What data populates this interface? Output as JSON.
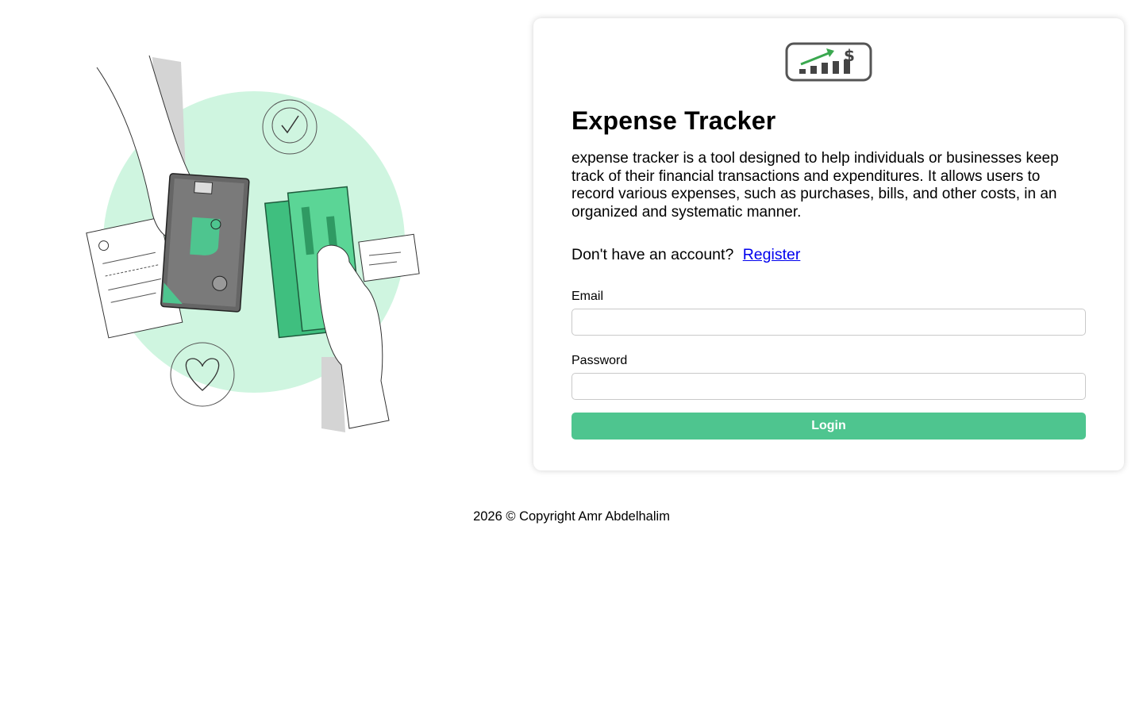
{
  "app": {
    "title": "Expense Tracker",
    "description": "expense tracker is a tool designed to help individuals or businesses keep track of their financial transactions and expenditures. It allows users to record various expenses, such as purchases, bills, and other costs, in an organized and systematic manner."
  },
  "register": {
    "prompt": "Don't have an account?",
    "link_label": "Register"
  },
  "form": {
    "email_label": "Email",
    "email_value": "",
    "password_label": "Password",
    "password_value": "",
    "login_label": "Login"
  },
  "footer": {
    "copyright": "2026 © Copyright Amr Abdelhalim"
  },
  "colors": {
    "accent": "#4ec58f",
    "link": "#0000ee",
    "illustration_bg": "#cff5e0",
    "logo_arrow": "#3aa84f"
  },
  "icons": {
    "logo": "expense-chart-logo-icon",
    "illustration": "money-exchange-illustration"
  }
}
